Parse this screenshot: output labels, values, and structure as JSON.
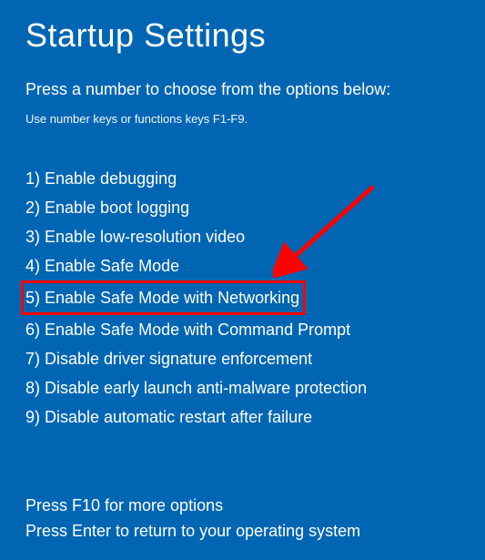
{
  "title": "Startup Settings",
  "subtitle": "Press a number to choose from the options below:",
  "hint": "Use number keys or functions keys F1-F9.",
  "options": [
    {
      "num": "1",
      "label": "Enable debugging"
    },
    {
      "num": "2",
      "label": "Enable boot logging"
    },
    {
      "num": "3",
      "label": "Enable low-resolution video"
    },
    {
      "num": "4",
      "label": "Enable Safe Mode"
    },
    {
      "num": "5",
      "label": "Enable Safe Mode with Networking"
    },
    {
      "num": "6",
      "label": "Enable Safe Mode with Command Prompt"
    },
    {
      "num": "7",
      "label": "Disable driver signature enforcement"
    },
    {
      "num": "8",
      "label": "Disable early launch anti-malware protection"
    },
    {
      "num": "9",
      "label": "Disable automatic restart after failure"
    }
  ],
  "highlighted_index": 4,
  "footer": {
    "line1": "Press F10 for more options",
    "line2": "Press Enter to return to your operating system"
  },
  "annotation": {
    "arrow_color": "#ff0000",
    "highlight_color": "#ff0000"
  }
}
